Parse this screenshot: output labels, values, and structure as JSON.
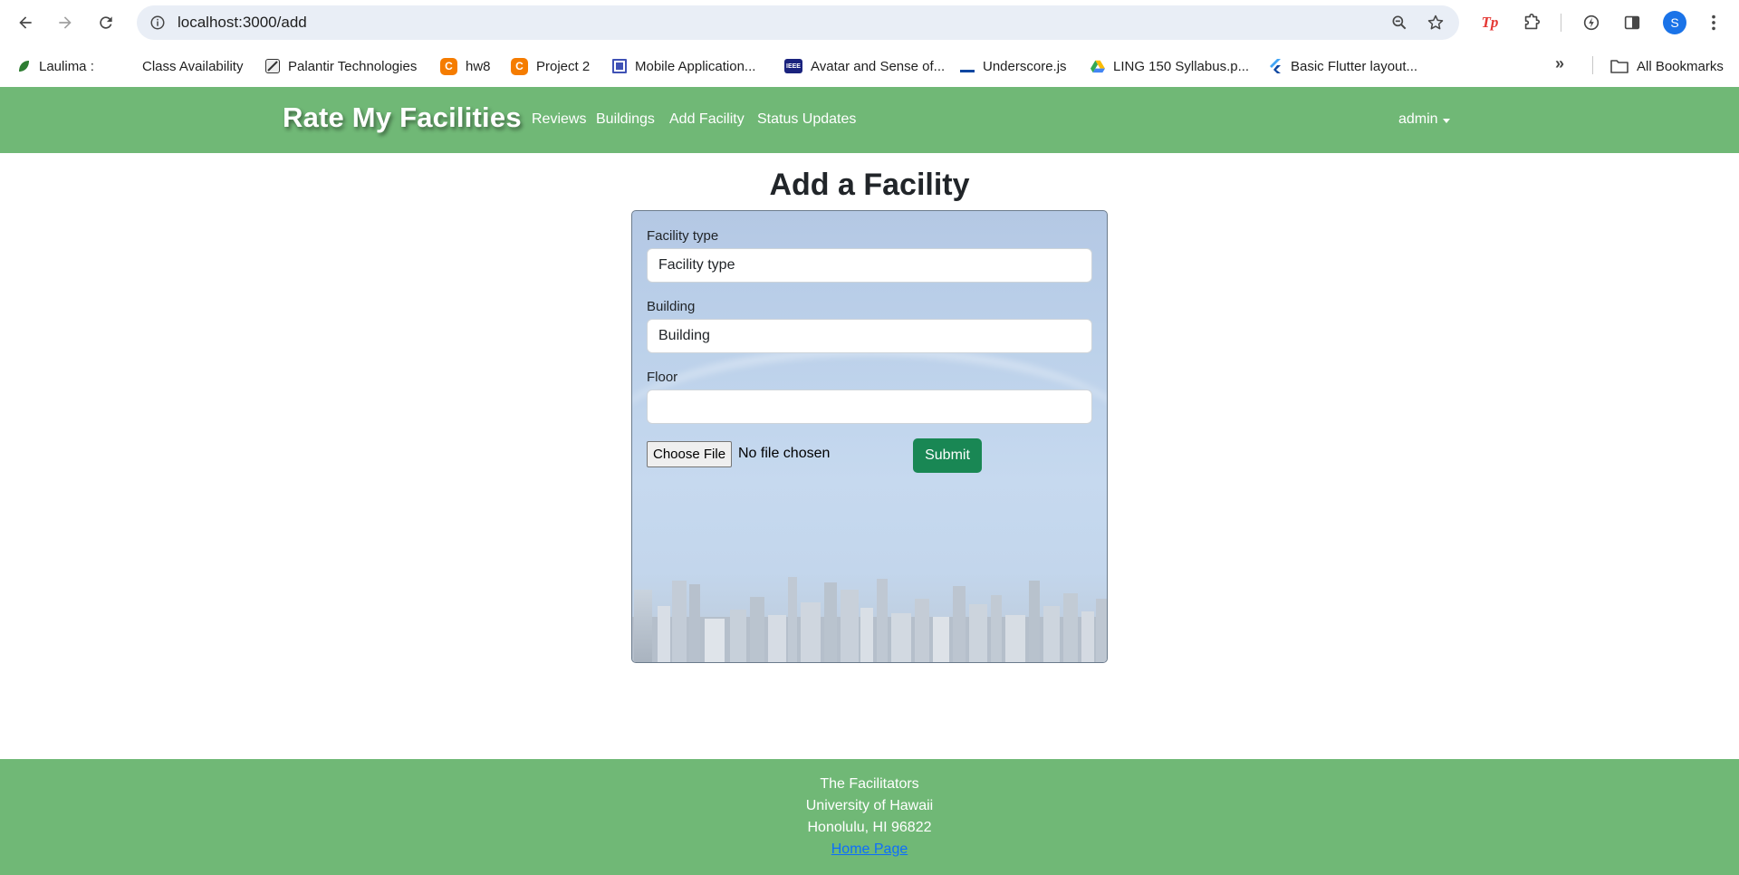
{
  "browser": {
    "url": "localhost:3000/add",
    "profile_initial": "S",
    "bookmarks": [
      {
        "label": "Laulima :",
        "icon": "leaf-icon",
        "color": "#2e7d32"
      },
      {
        "label": "Class Availability",
        "icon": "",
        "color": ""
      },
      {
        "label": "Palantir Technologies",
        "icon": "palantir-icon",
        "color": "#333333"
      },
      {
        "label": "hw8",
        "icon": "c-icon",
        "color": "#f57c00"
      },
      {
        "label": "Project 2",
        "icon": "c-icon",
        "color": "#f57c00"
      },
      {
        "label": "Mobile Application...",
        "icon": "document-icon",
        "color": "#3f51b5"
      },
      {
        "label": "Avatar and Sense of...",
        "icon": "ieee-icon",
        "color": "#1a237e"
      },
      {
        "label": "Underscore.js",
        "icon": "underscore-icon",
        "color": "#0d47a1"
      },
      {
        "label": "LING 150 Syllabus.p...",
        "icon": "drive-icon",
        "color": "#34a853"
      },
      {
        "label": "Basic Flutter layout...",
        "icon": "flutter-icon",
        "color": "#42a5f5"
      }
    ],
    "all_bookmarks": "All Bookmarks"
  },
  "navbar": {
    "brand": "Rate My Facilities",
    "links": [
      "Reviews",
      "Buildings",
      "Add Facility",
      "Status Updates"
    ],
    "user": "admin"
  },
  "form": {
    "title": "Add a Facility",
    "facility_type_label": "Facility type",
    "facility_type_value": "Facility type",
    "building_label": "Building",
    "building_value": "Building",
    "floor_label": "Floor",
    "floor_value": "",
    "choose_file": "Choose File",
    "file_status": "No file chosen",
    "submit": "Submit"
  },
  "footer": {
    "line1": "The Facilitators",
    "line2": "University of Hawaii",
    "line3": "Honolulu, HI 96822",
    "home_link": "Home Page"
  },
  "colors": {
    "navbar": "#70b876",
    "submit": "#198754",
    "link": "#0d6efd"
  }
}
